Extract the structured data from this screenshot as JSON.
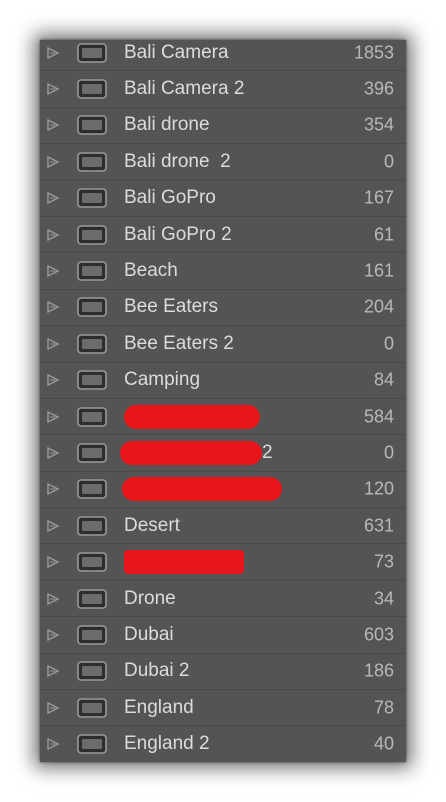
{
  "colors": {
    "panel_bg": "#545454",
    "label_text": "#dcdcdc",
    "count_text": "#b8b8b8",
    "redaction": "#e8161a"
  },
  "icons": {
    "expand": "triangle-right-icon",
    "folder": "folder-icon"
  },
  "folders": [
    {
      "label": "Bali Camera",
      "count": "1853"
    },
    {
      "label": "Bali Camera 2",
      "count": "396"
    },
    {
      "label": "Bali drone",
      "count": "354"
    },
    {
      "label": "Bali drone  2",
      "count": "0"
    },
    {
      "label": "Bali GoPro",
      "count": "167"
    },
    {
      "label": "Bali GoPro 2",
      "count": "61"
    },
    {
      "label": "Beach",
      "count": "161"
    },
    {
      "label": "Bee Eaters",
      "count": "204"
    },
    {
      "label": "Bee Eaters 2",
      "count": "0"
    },
    {
      "label": "Camping",
      "count": "84"
    },
    {
      "label": "",
      "count": "584",
      "redacted": true
    },
    {
      "label": "2",
      "count": "0",
      "redacted": true
    },
    {
      "label": "",
      "count": "120",
      "redacted": true
    },
    {
      "label": "Desert",
      "count": "631"
    },
    {
      "label": "",
      "count": "73",
      "redacted": true
    },
    {
      "label": "Drone",
      "count": "34"
    },
    {
      "label": "Dubai",
      "count": "603"
    },
    {
      "label": "Dubai 2",
      "count": "186"
    },
    {
      "label": "England",
      "count": "78"
    },
    {
      "label": "England 2",
      "count": "40"
    }
  ]
}
